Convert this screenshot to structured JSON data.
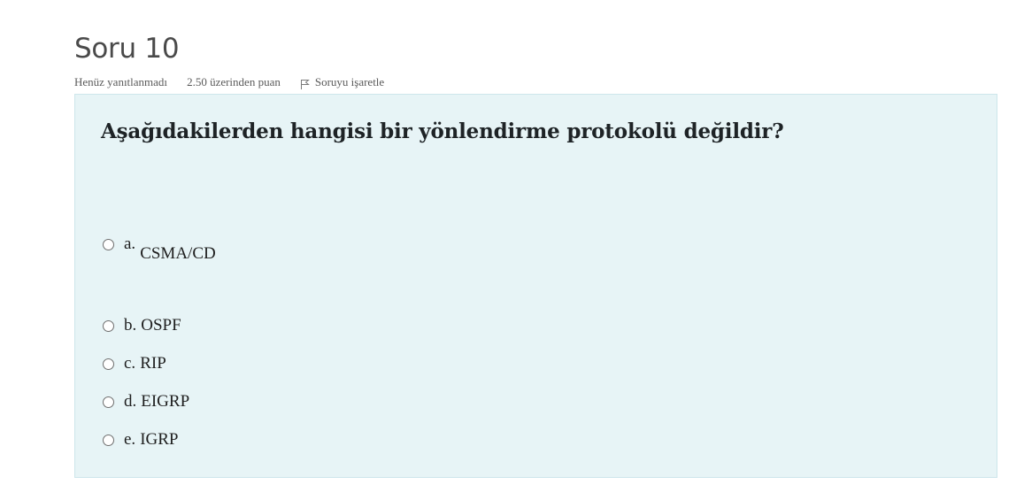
{
  "question": {
    "heading": "Soru 10",
    "status": "Henüz yanıtlanmadı",
    "points": "2.50 üzerinden puan",
    "flag_label": "Soruyu işaretle",
    "text": "Aşağıdakilerden hangisi bir yönlendirme protokolü değildir?",
    "options": [
      {
        "letter": "a.",
        "text": "CSMA/CD",
        "selected": false
      },
      {
        "letter": "b.",
        "text": "OSPF",
        "selected": false
      },
      {
        "letter": "c.",
        "text": "RIP",
        "selected": false
      },
      {
        "letter": "d.",
        "text": "EIGRP",
        "selected": false
      },
      {
        "letter": "e.",
        "text": "IGRP",
        "selected": false
      }
    ]
  },
  "colors": {
    "box_background": "#e7f4f6",
    "box_border": "#cde6eb"
  },
  "icons": {
    "flag": "flag-icon"
  }
}
